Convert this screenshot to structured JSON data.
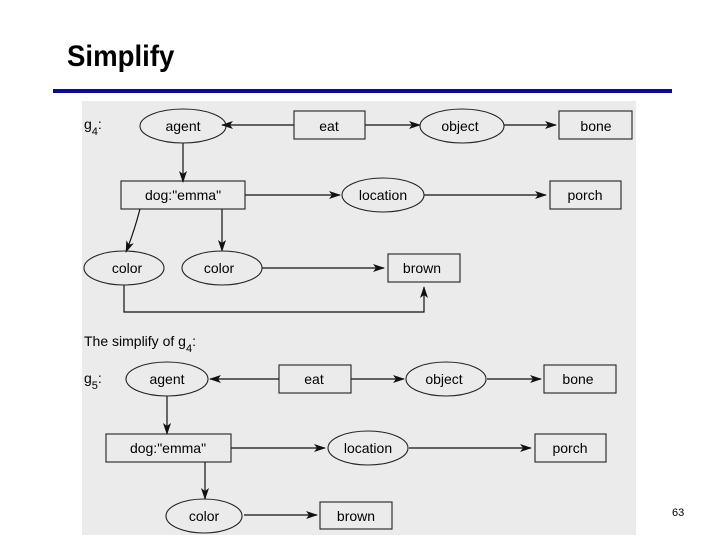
{
  "slide": {
    "title": "Simplify",
    "page_number": "63",
    "accent_color": "#0a0a9a",
    "panel_color": "#ebebeb"
  },
  "graph_g4": {
    "label_base": "g",
    "label_sub": "4",
    "label_suffix": ":",
    "nodes": {
      "agent": {
        "label": "agent",
        "shape": "ellipse"
      },
      "eat": {
        "label": "eat",
        "shape": "rect"
      },
      "object": {
        "label": "object",
        "shape": "ellipse"
      },
      "bone": {
        "label": "bone",
        "shape": "rect"
      },
      "dog": {
        "label": "dog:\"emma\"",
        "shape": "rect"
      },
      "location": {
        "label": "location",
        "shape": "ellipse"
      },
      "porch": {
        "label": "porch",
        "shape": "rect"
      },
      "color1": {
        "label": "color",
        "shape": "ellipse"
      },
      "color2": {
        "label": "color",
        "shape": "ellipse"
      },
      "brown": {
        "label": "brown",
        "shape": "rect"
      }
    },
    "edges": [
      {
        "from": "eat",
        "to": "agent"
      },
      {
        "from": "eat",
        "to": "object"
      },
      {
        "from": "object",
        "to": "bone"
      },
      {
        "from": "agent",
        "to": "dog"
      },
      {
        "from": "dog",
        "to": "location"
      },
      {
        "from": "location",
        "to": "porch"
      },
      {
        "from": "dog",
        "to": "color1"
      },
      {
        "from": "dog",
        "to": "color2"
      },
      {
        "from": "color2",
        "to": "brown"
      },
      {
        "from": "color1",
        "to": "brown"
      }
    ]
  },
  "caption": {
    "text": "The simplify of g",
    "sub": "4",
    "suffix": ":"
  },
  "graph_g5": {
    "label_base": "g",
    "label_sub": "5",
    "label_suffix": ":",
    "nodes": {
      "agent": {
        "label": "agent",
        "shape": "ellipse"
      },
      "eat": {
        "label": "eat",
        "shape": "rect"
      },
      "object": {
        "label": "object",
        "shape": "ellipse"
      },
      "bone": {
        "label": "bone",
        "shape": "rect"
      },
      "dog": {
        "label": "dog:\"emma\"",
        "shape": "rect"
      },
      "location": {
        "label": "location",
        "shape": "ellipse"
      },
      "porch": {
        "label": "porch",
        "shape": "rect"
      },
      "color": {
        "label": "color",
        "shape": "ellipse"
      },
      "brown": {
        "label": "brown",
        "shape": "rect"
      }
    },
    "edges": [
      {
        "from": "eat",
        "to": "agent"
      },
      {
        "from": "eat",
        "to": "object"
      },
      {
        "from": "object",
        "to": "bone"
      },
      {
        "from": "agent",
        "to": "dog"
      },
      {
        "from": "dog",
        "to": "location"
      },
      {
        "from": "location",
        "to": "porch"
      },
      {
        "from": "dog",
        "to": "color"
      },
      {
        "from": "color",
        "to": "brown"
      }
    ]
  }
}
